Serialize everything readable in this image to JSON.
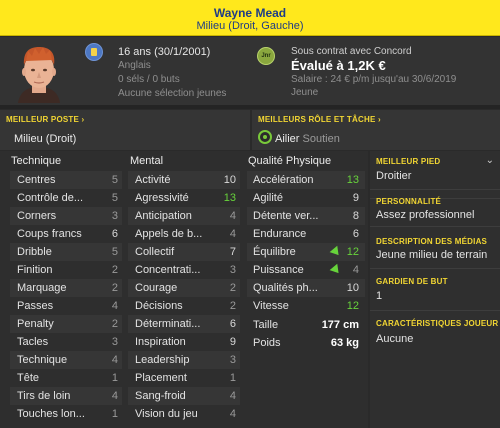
{
  "header": {
    "name": "Wayne Mead",
    "position": "Milieu (Droit, Gauche)"
  },
  "player": {
    "age_line": "16 ans (30/1/2001)",
    "nationality": "Anglais",
    "goals_line": "0 séls / 0 buts",
    "youth_line": "Aucune sélection jeunes"
  },
  "contract": {
    "line1": "Sous contrat avec Concord",
    "value": "Évalué à 1,2K €",
    "salary": "Salaire : 24 € p/m jusqu'au 30/6/2019",
    "status": "Jeune",
    "club_badge": "Jnr"
  },
  "best_position": {
    "title": "MEILLEUR POSTE",
    "value": "Milieu (Droit)"
  },
  "best_role": {
    "title": "MEILLEURS RÔLE ET TÂCHE",
    "role": "Ailier",
    "duty": "Soutien"
  },
  "technique": {
    "title": "Technique",
    "rows": [
      {
        "label": "Centres",
        "value": "5"
      },
      {
        "label": "Contrôle de...",
        "value": "5"
      },
      {
        "label": "Corners",
        "value": "3"
      },
      {
        "label": "Coups francs",
        "value": "6"
      },
      {
        "label": "Dribble",
        "value": "5"
      },
      {
        "label": "Finition",
        "value": "2"
      },
      {
        "label": "Marquage",
        "value": "2"
      },
      {
        "label": "Passes",
        "value": "4"
      },
      {
        "label": "Penalty",
        "value": "2"
      },
      {
        "label": "Tacles",
        "value": "3"
      },
      {
        "label": "Technique",
        "value": "4"
      },
      {
        "label": "Tête",
        "value": "1"
      },
      {
        "label": "Tirs de loin",
        "value": "4"
      },
      {
        "label": "Touches lon...",
        "value": "1"
      }
    ]
  },
  "mental": {
    "title": "Mental",
    "rows": [
      {
        "label": "Activité",
        "value": "10"
      },
      {
        "label": "Agressivité",
        "value": "13"
      },
      {
        "label": "Anticipation",
        "value": "4"
      },
      {
        "label": "Appels de b...",
        "value": "4"
      },
      {
        "label": "Collectif",
        "value": "7"
      },
      {
        "label": "Concentrati...",
        "value": "3"
      },
      {
        "label": "Courage",
        "value": "2"
      },
      {
        "label": "Décisions",
        "value": "2"
      },
      {
        "label": "Déterminati...",
        "value": "6"
      },
      {
        "label": "Inspiration",
        "value": "9"
      },
      {
        "label": "Leadership",
        "value": "3"
      },
      {
        "label": "Placement",
        "value": "1"
      },
      {
        "label": "Sang-froid",
        "value": "4"
      },
      {
        "label": "Vision du jeu",
        "value": "4"
      }
    ]
  },
  "physical": {
    "title": "Qualité Physique",
    "rows": [
      {
        "label": "Accélération",
        "value": "13"
      },
      {
        "label": "Agilité",
        "value": "9"
      },
      {
        "label": "Détente ver...",
        "value": "8"
      },
      {
        "label": "Endurance",
        "value": "6"
      },
      {
        "label": "Équilibre",
        "value": "12"
      },
      {
        "label": "Puissance",
        "value": "4"
      },
      {
        "label": "Qualités ph...",
        "value": "10"
      },
      {
        "label": "Vitesse",
        "value": "12"
      }
    ],
    "height_label": "Taille",
    "height_value": "177 cm",
    "weight_label": "Poids",
    "weight_value": "63 kg"
  },
  "side": {
    "foot_title": "MEILLEUR PIED",
    "foot_value": "Droitier",
    "personality_title": "PERSONNALITÉ",
    "personality_value": "Assez professionnel",
    "media_title": "DESCRIPTION DES MÉDIAS",
    "media_value": "Jeune milieu de terrain",
    "gk_title": "GARDIEN DE BUT",
    "gk_value": "1",
    "traits_title": "CARACTÉRISTIQUES JOUEUR",
    "traits_value": "Aucune"
  },
  "colors": {
    "accent": "#ffe81c",
    "title_blue": "#1f3c86",
    "section_yellow": "#f2d633",
    "high_green": "#67d33b"
  }
}
